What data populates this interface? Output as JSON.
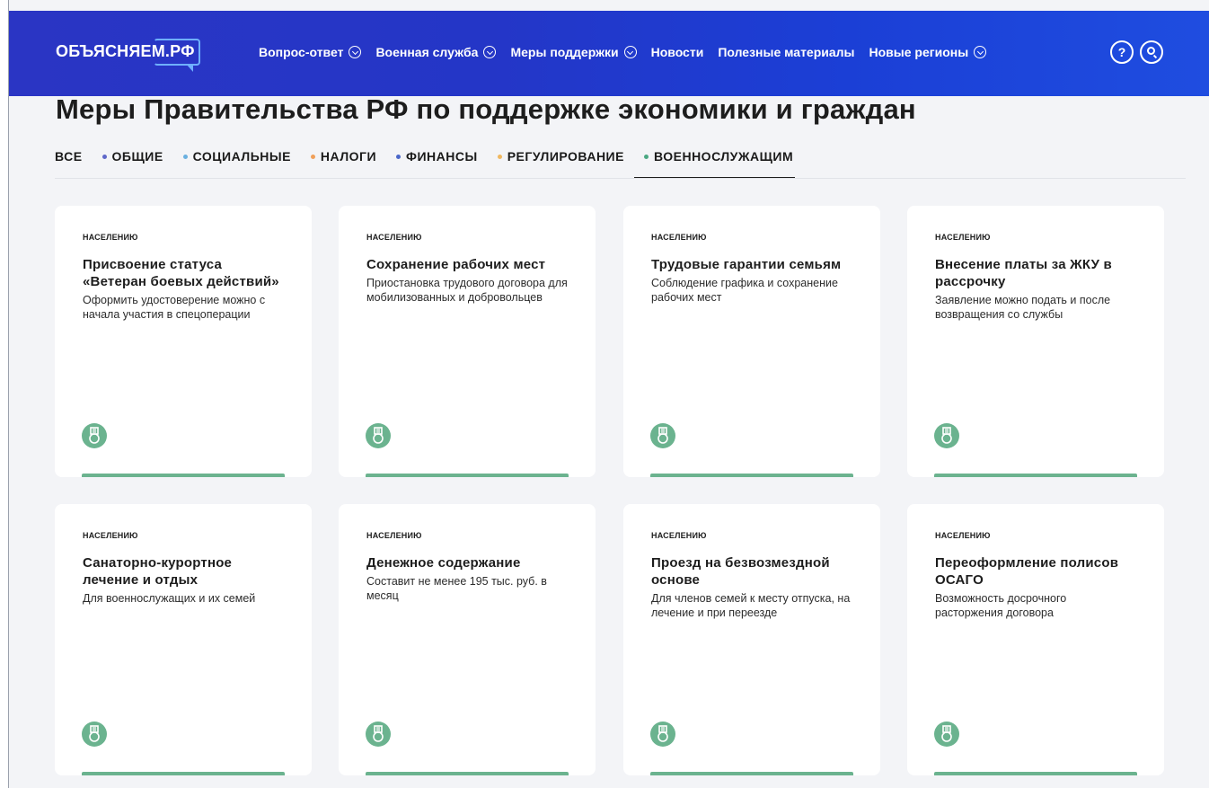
{
  "logo": "ОБЪЯСНЯЕМ.РФ",
  "nav": [
    {
      "label": "Вопрос-ответ",
      "dropdown": true
    },
    {
      "label": "Военная служба",
      "dropdown": true
    },
    {
      "label": "Меры поддержки",
      "dropdown": true
    },
    {
      "label": "Новости",
      "dropdown": false
    },
    {
      "label": "Полезные материалы",
      "dropdown": false
    },
    {
      "label": "Новые регионы",
      "dropdown": true
    }
  ],
  "help_label": "?",
  "page_title": "Меры Правительства РФ по поддержке экономики и граждан",
  "tabs": [
    {
      "label": "ВСЕ",
      "dot": null
    },
    {
      "label": "ОБЩИЕ",
      "dot": "#5e67c9"
    },
    {
      "label": "СОЦИАЛЬНЫЕ",
      "dot": "#6ab0e0"
    },
    {
      "label": "НАЛОГИ",
      "dot": "#f0a05a"
    },
    {
      "label": "ФИНАНСЫ",
      "dot": "#4a67c9"
    },
    {
      "label": "РЕГУЛИРОВАНИЕ",
      "dot": "#f0b860"
    },
    {
      "label": "ВОЕННОСЛУЖАЩИМ",
      "dot": "#4aa882",
      "active": true
    }
  ],
  "accent_color": "#6bb38f",
  "cards": [
    {
      "category": "НАСЕЛЕНИЮ",
      "title": "Присвоение статуса «Ветеран боевых действий»",
      "description": "Оформить удостоверение можно с начала участия в спецоперации",
      "icon": "medal-icon"
    },
    {
      "category": "НАСЕЛЕНИЮ",
      "title": "Сохранение рабочих мест",
      "description": "Приостановка трудового договора для мобилизованных и добровольцев",
      "icon": "medal-icon"
    },
    {
      "category": "НАСЕЛЕНИЮ",
      "title": "Трудовые гарантии семьям",
      "description": "Соблюдение графика и сохранение рабочих мест",
      "icon": "medal-icon"
    },
    {
      "category": "НАСЕЛЕНИЮ",
      "title": "Внесение платы за ЖКУ в рассрочку",
      "description": "Заявление можно подать и после возвращения со службы",
      "icon": "medal-icon"
    },
    {
      "category": "НАСЕЛЕНИЮ",
      "title": "Санаторно-курортное лечение и отдых",
      "description": "Для военнослужащих и их семей",
      "icon": "medal-icon"
    },
    {
      "category": "НАСЕЛЕНИЮ",
      "title": "Денежное содержание",
      "description": "Составит не менее 195 тыс. руб. в месяц",
      "icon": "medal-icon"
    },
    {
      "category": "НАСЕЛЕНИЮ",
      "title": "Проезд на безвозмездной основе",
      "description": "Для членов семей к месту отпуска, на лечение и при переезде",
      "icon": "medal-icon"
    },
    {
      "category": "НАСЕЛЕНИЮ",
      "title": "Переоформление полисов ОСАГО",
      "description": "Возможность досрочного расторжения договора",
      "icon": "medal-icon"
    }
  ]
}
